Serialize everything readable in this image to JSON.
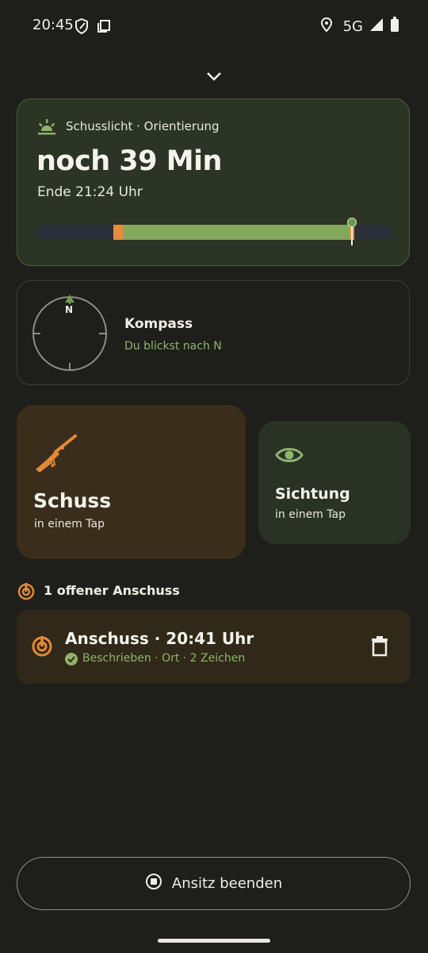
{
  "status_bar": {
    "time": "20:45",
    "network": "5G",
    "icons": [
      "shield-icon",
      "copy-icon",
      "location-icon",
      "signal-icon",
      "battery-icon"
    ]
  },
  "collapse": {
    "icon": "chevron-down-icon"
  },
  "light_card": {
    "label": "Schusslicht · Orientierung",
    "remaining": "noch 39 Min",
    "end": "Ende 21:24 Uhr",
    "progress": {
      "orange_start": 0.216,
      "green_start": 0.242,
      "green_end": 0.88,
      "now": 0.88
    },
    "colors": {
      "track": "#2a2f38",
      "green": "#83a85c",
      "orange": "#e88b3e",
      "marker": "#6f9a4d"
    }
  },
  "compass_card": {
    "title": "Kompass",
    "subtitle": "Du blickst nach N",
    "north_label": "N"
  },
  "schuss_card": {
    "title": "Schuss",
    "subtitle": "in einem Tap",
    "icon": "rifle-icon"
  },
  "sichtung_card": {
    "title": "Sichtung",
    "subtitle": "in einem Tap",
    "icon": "eye-icon"
  },
  "open_section": {
    "label": "1 offener Anschuss",
    "icon": "target-icon"
  },
  "anschuss_item": {
    "title": "Anschuss · 20:41 Uhr",
    "status": "Beschrieben · Ort · 2 Zeichen",
    "icons": [
      "target-icon",
      "check-circle-icon",
      "trash-icon"
    ]
  },
  "end_button": {
    "label": "Ansitz beenden",
    "icon": "stop-circle-icon"
  },
  "colors": {
    "accent_green": "#8fb36c",
    "accent_orange": "#e28a35",
    "background": "#1e1f1a"
  }
}
